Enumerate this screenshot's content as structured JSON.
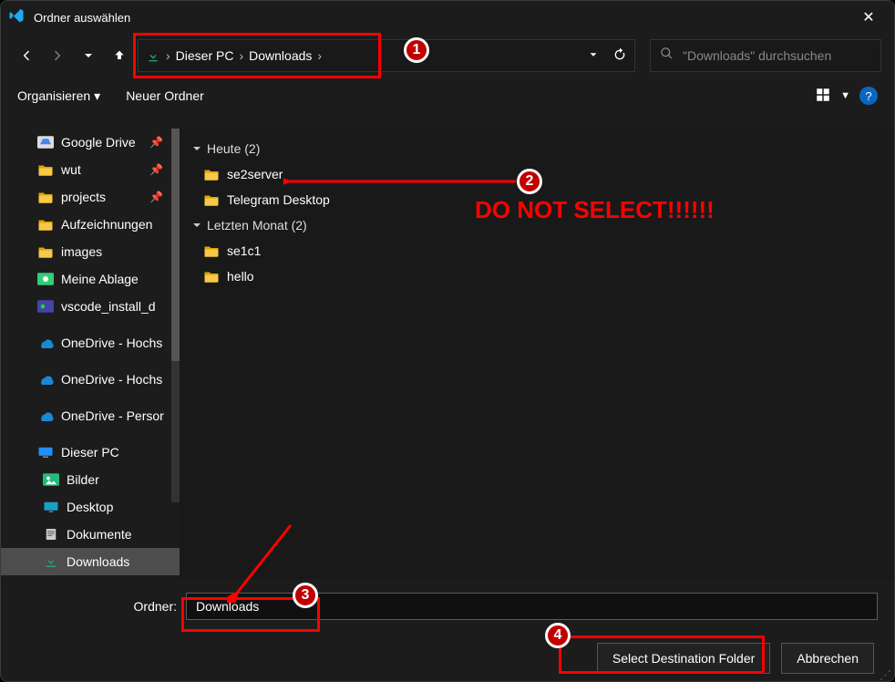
{
  "window": {
    "title": "Ordner auswählen"
  },
  "nav": {
    "breadcrumb": [
      "Dieser PC",
      "Downloads"
    ],
    "search_placeholder": "\"Downloads\" durchsuchen"
  },
  "toolbar": {
    "organize": "Organisieren",
    "new_folder": "Neuer Ordner"
  },
  "sidebar": {
    "items": [
      {
        "name": "Google Drive",
        "icon": "gdrive",
        "pinned": true
      },
      {
        "name": "wut",
        "icon": "folder",
        "pinned": true
      },
      {
        "name": "projects",
        "icon": "folder",
        "pinned": true
      },
      {
        "name": "Aufzeichnungen",
        "icon": "folder"
      },
      {
        "name": "images",
        "icon": "folder"
      },
      {
        "name": "Meine Ablage",
        "icon": "gdrive-disk"
      },
      {
        "name": "vscode_install_d",
        "icon": "gdrive-file"
      },
      {
        "name": "OneDrive - Hochs",
        "icon": "onedrive",
        "gap_before": true
      },
      {
        "name": "OneDrive - Hochs",
        "icon": "onedrive",
        "gap_before": true
      },
      {
        "name": "OneDrive - Persor",
        "icon": "onedrive",
        "gap_before": true
      },
      {
        "name": "Dieser PC",
        "icon": "pc",
        "gap_before": true
      },
      {
        "name": "Bilder",
        "icon": "bilder",
        "indent": true
      },
      {
        "name": "Desktop",
        "icon": "desktop",
        "indent": true
      },
      {
        "name": "Dokumente",
        "icon": "dokumente",
        "indent": true
      },
      {
        "name": "Downloads",
        "icon": "download",
        "indent": true,
        "selected": true
      },
      {
        "name": "",
        "icon": "blank",
        "indent": true
      }
    ]
  },
  "filelist": {
    "groups": [
      {
        "label": "Heute (2)",
        "items": [
          {
            "name": "se2server"
          },
          {
            "name": "Telegram Desktop"
          }
        ]
      },
      {
        "label": "Letzten Monat (2)",
        "items": [
          {
            "name": "se1c1"
          },
          {
            "name": "hello"
          }
        ]
      }
    ]
  },
  "footer": {
    "folder_label": "Ordner:",
    "folder_value": "Downloads",
    "select_btn": "Select Destination Folder",
    "cancel_btn": "Abbrechen"
  },
  "annotations": {
    "warning": "DO NOT SELECT!!!!!!",
    "badges": [
      "1",
      "2",
      "3",
      "4"
    ]
  }
}
